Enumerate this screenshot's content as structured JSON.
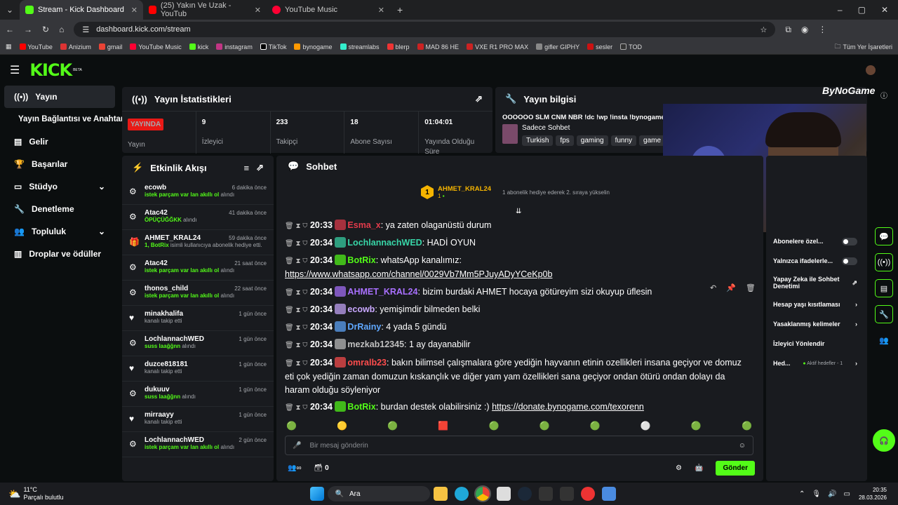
{
  "browser": {
    "tabs": [
      {
        "title": "Stream - Kick Dashboard"
      },
      {
        "title": "(25) Yakın Ve Uzak - YouTub"
      },
      {
        "title": "YouTube Music"
      }
    ],
    "url": "dashboard.kick.com/stream"
  },
  "bookmarks": [
    "YouTube",
    "Anizium",
    "gmail",
    "YouTube Music",
    "kick",
    "instagram",
    "TikTok",
    "bynogame",
    "streamlabs",
    "blerp",
    "MAD 86 HE",
    "VXE R1 PRO MAX",
    "gifler GIPHY",
    "sesler",
    "TOD"
  ],
  "bookmarks_all": "Tüm Yer İşaretleri",
  "logo": "KICK",
  "logo_beta": "BETA",
  "sidebar": {
    "items": [
      {
        "label": "Yayın"
      },
      {
        "label": "Yayın Bağlantısı ve Anahtarı"
      },
      {
        "label": "Gelir"
      },
      {
        "label": "Başarılar"
      },
      {
        "label": "Stüdyo"
      },
      {
        "label": "Denetleme"
      },
      {
        "label": "Topluluk"
      },
      {
        "label": "Droplar ve ödüller"
      }
    ]
  },
  "stats": {
    "title": "Yayın İstatistikleri",
    "live": "YAYINDA",
    "live_label": "Yayın",
    "cells": [
      {
        "value": "9",
        "label": "İzleyici"
      },
      {
        "value": "233",
        "label": "Takipçi"
      },
      {
        "value": "18",
        "label": "Abone Sayısı"
      },
      {
        "value": "01:04:01",
        "label": "Yayında Olduğu Süre"
      }
    ]
  },
  "info": {
    "title": "Yayın bilgisi",
    "stream_title": "OOOOOO SLM CNM NBR !dc !wp !insta !bynogame",
    "category": "Sadece Sohbet",
    "tags": [
      "Turkish",
      "fps",
      "gaming",
      "funny",
      "game"
    ]
  },
  "overlay": {
    "brand": "ByNoGame"
  },
  "activity": {
    "title": "Etkinlik Akışı",
    "items": [
      {
        "user": "ecowb",
        "time": "6 dakika önce",
        "desc": "istek parçam var lan akıllı ol",
        "suffix": "alındı"
      },
      {
        "user": "Atac42",
        "time": "41 dakika önce",
        "desc": "ÖPÜÇÜĞĞKK",
        "suffix": "alındı"
      },
      {
        "user": "AHMET_KRAL24",
        "time": "59 dakika önce",
        "desc": "1, BotRix",
        "suffix": "isimli kullanıcıya abonelik hediye etti."
      },
      {
        "user": "Atac42",
        "time": "21 saat önce",
        "desc": "istek parçam var lan akıllı ol",
        "suffix": "alındı"
      },
      {
        "user": "thonos_child",
        "time": "22 saat önce",
        "desc": "istek parçam var lan akıllı ol",
        "suffix": "alındı"
      },
      {
        "user": "minakhalifa",
        "time": "1 gün önce",
        "desc": "",
        "suffix": "kanalı takip etti"
      },
      {
        "user": "LochlannachWED",
        "time": "1 gün önce",
        "desc": "suss laağğnn",
        "suffix": "alındı"
      },
      {
        "user": "duzce818181",
        "time": "1 gün önce",
        "desc": "",
        "suffix": "kanalı takip etti"
      },
      {
        "user": "dukuuv",
        "time": "1 gün önce",
        "desc": "suss laağğnn",
        "suffix": "alındı"
      },
      {
        "user": "mirraayy",
        "time": "1 gün önce",
        "desc": "",
        "suffix": "kanalı takip etti"
      },
      {
        "user": "LochlannachWED",
        "time": "2 gün önce",
        "desc": "istek parçam var lan akıllı ol",
        "suffix": "alındı"
      }
    ]
  },
  "chat": {
    "title": "Sohbet",
    "pinned_user": "AHMET_KRAL24",
    "pinned_rank": "1",
    "pinned_count": "1",
    "pinned_note": "1 abonelik hediye ederek 2. sıraya yükselin",
    "messages": [
      {
        "time": "20:33",
        "user": "Esma_x",
        "color": "#e23b4b",
        "text": ": ya zaten olaganüstü durum"
      },
      {
        "time": "20:34",
        "user": "LochlannachWED",
        "color": "#38d6a8",
        "text": ": HADİ OYUN"
      },
      {
        "time": "20:34",
        "user": "BotRix",
        "color": "#53fc18",
        "text": ": whatsApp kanalımız:",
        "link": "https://www.whatsapp.com/channel/0029Vb7Mm5PJuyADyYCeKp0b"
      },
      {
        "time": "20:34",
        "user": "AHMET_KRAL24",
        "color": "#a970ff",
        "text": ": bizim burdaki AHMET hocaya götüreyim sizi okuyup üflesin"
      },
      {
        "time": "20:34",
        "user": "ecowb",
        "color": "#c9a8ff",
        "text": ": yemişimdir bilmeden belki"
      },
      {
        "time": "20:34",
        "user": "DrRainy",
        "color": "#5fa8ff",
        "text": ": 4 yada 5 gündü"
      },
      {
        "time": "20:34",
        "user": "mezkab12345",
        "color": "#c0c0c0",
        "text": ": 1 ay dayanabilir"
      },
      {
        "time": "20:34",
        "user": "omralb23",
        "color": "#ff4d4d",
        "text": ": bakın bilimsel çalışmalara göre yediğin hayvanın etinin ozellikleri insana geçiyor ve domuz",
        "line2": "eti çok yediğin zaman domuzun kıskançlık ve diğer yam yam özellikleri sana geçiyor ondan ötürü ondan dolayı da",
        "line3": "haram olduğu söyleniyor"
      },
      {
        "time": "20:34",
        "user": "BotRix",
        "color": "#53fc18",
        "text": ": burdan destek olabilirsiniz :)",
        "link": "https://donate.bynogame.com/texorenn"
      }
    ],
    "placeholder": "Bir mesaj gönderin",
    "send": "Gönder",
    "count": "0"
  },
  "settings": {
    "items": [
      {
        "label": "Abonelere özel..."
      },
      {
        "label": "Yalnızca ifadelerle..."
      },
      {
        "label": "Yapay Zeka ile Sohbet Denetimi"
      },
      {
        "label": "Hesap yaşı kısıtlaması"
      },
      {
        "label": "Yasaklanmış kelimeler"
      },
      {
        "label": "İzleyici Yönlendir"
      },
      {
        "label": "Hed...",
        "extra": "Aktif hedefler - 1"
      }
    ]
  },
  "taskbar": {
    "temp": "11°C",
    "weather": "Parçalı bulutlu",
    "search": "Ara",
    "time": "20:35",
    "date": "28.03.2026"
  },
  "colors": {
    "accent": "#53fc18",
    "bg": "#0b0e0f",
    "panel": "#191b1f"
  }
}
